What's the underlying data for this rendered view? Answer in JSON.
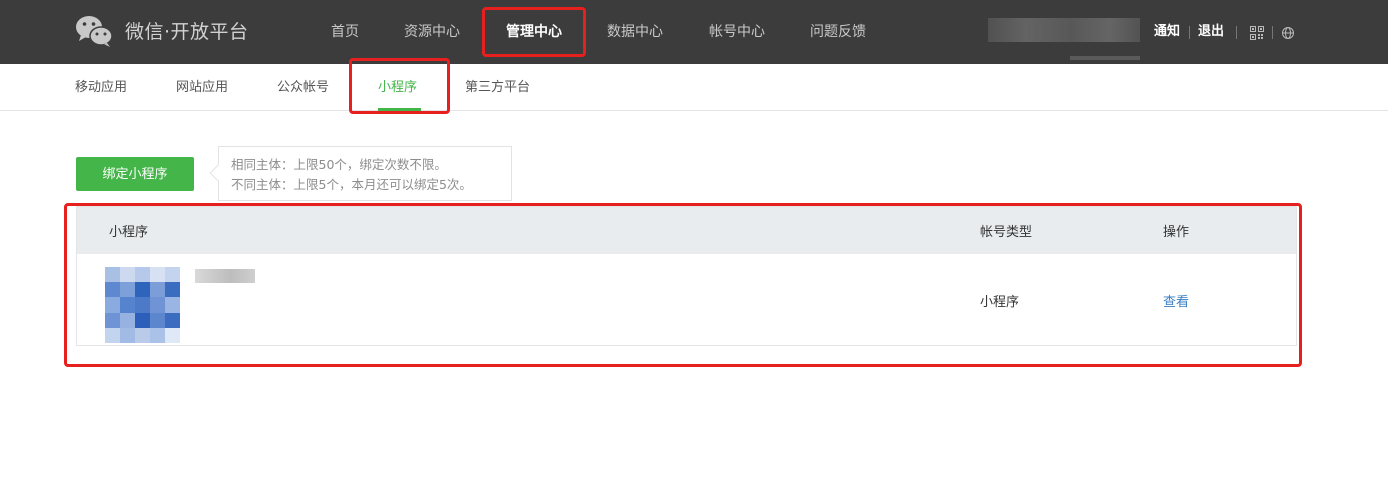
{
  "header": {
    "brand": "微信·开放平台",
    "nav": [
      {
        "label": "首页"
      },
      {
        "label": "资源中心"
      },
      {
        "label": "管理中心"
      },
      {
        "label": "数据中心"
      },
      {
        "label": "帐号中心"
      },
      {
        "label": "问题反馈"
      }
    ],
    "active_nav": "管理中心",
    "notify_label": "通知",
    "logout_label": "退出",
    "icons": [
      "wechat-logo",
      "qr-code-icon",
      "globe-icon"
    ]
  },
  "subnav": {
    "tabs": [
      {
        "label": "移动应用"
      },
      {
        "label": "网站应用"
      },
      {
        "label": "公众帐号"
      },
      {
        "label": "小程序"
      },
      {
        "label": "第三方平台"
      }
    ],
    "active_tab": "小程序"
  },
  "actions": {
    "bind_button": "绑定小程序",
    "tip_lines": [
      "相同主体：上限50个，绑定次数不限。",
      "不同主体：上限5个，本月还可以绑定5次。"
    ]
  },
  "table": {
    "columns": [
      "小程序",
      "帐号类型",
      "操作"
    ],
    "rows": [
      {
        "account_type": "小程序",
        "action": "查看"
      }
    ]
  },
  "colors": {
    "topbar": "#3c3c3c",
    "accent_green": "#44b549",
    "link_blue": "#3a7fc4",
    "highlight_red": "#e6201e",
    "table_header": "#e9ecef"
  }
}
